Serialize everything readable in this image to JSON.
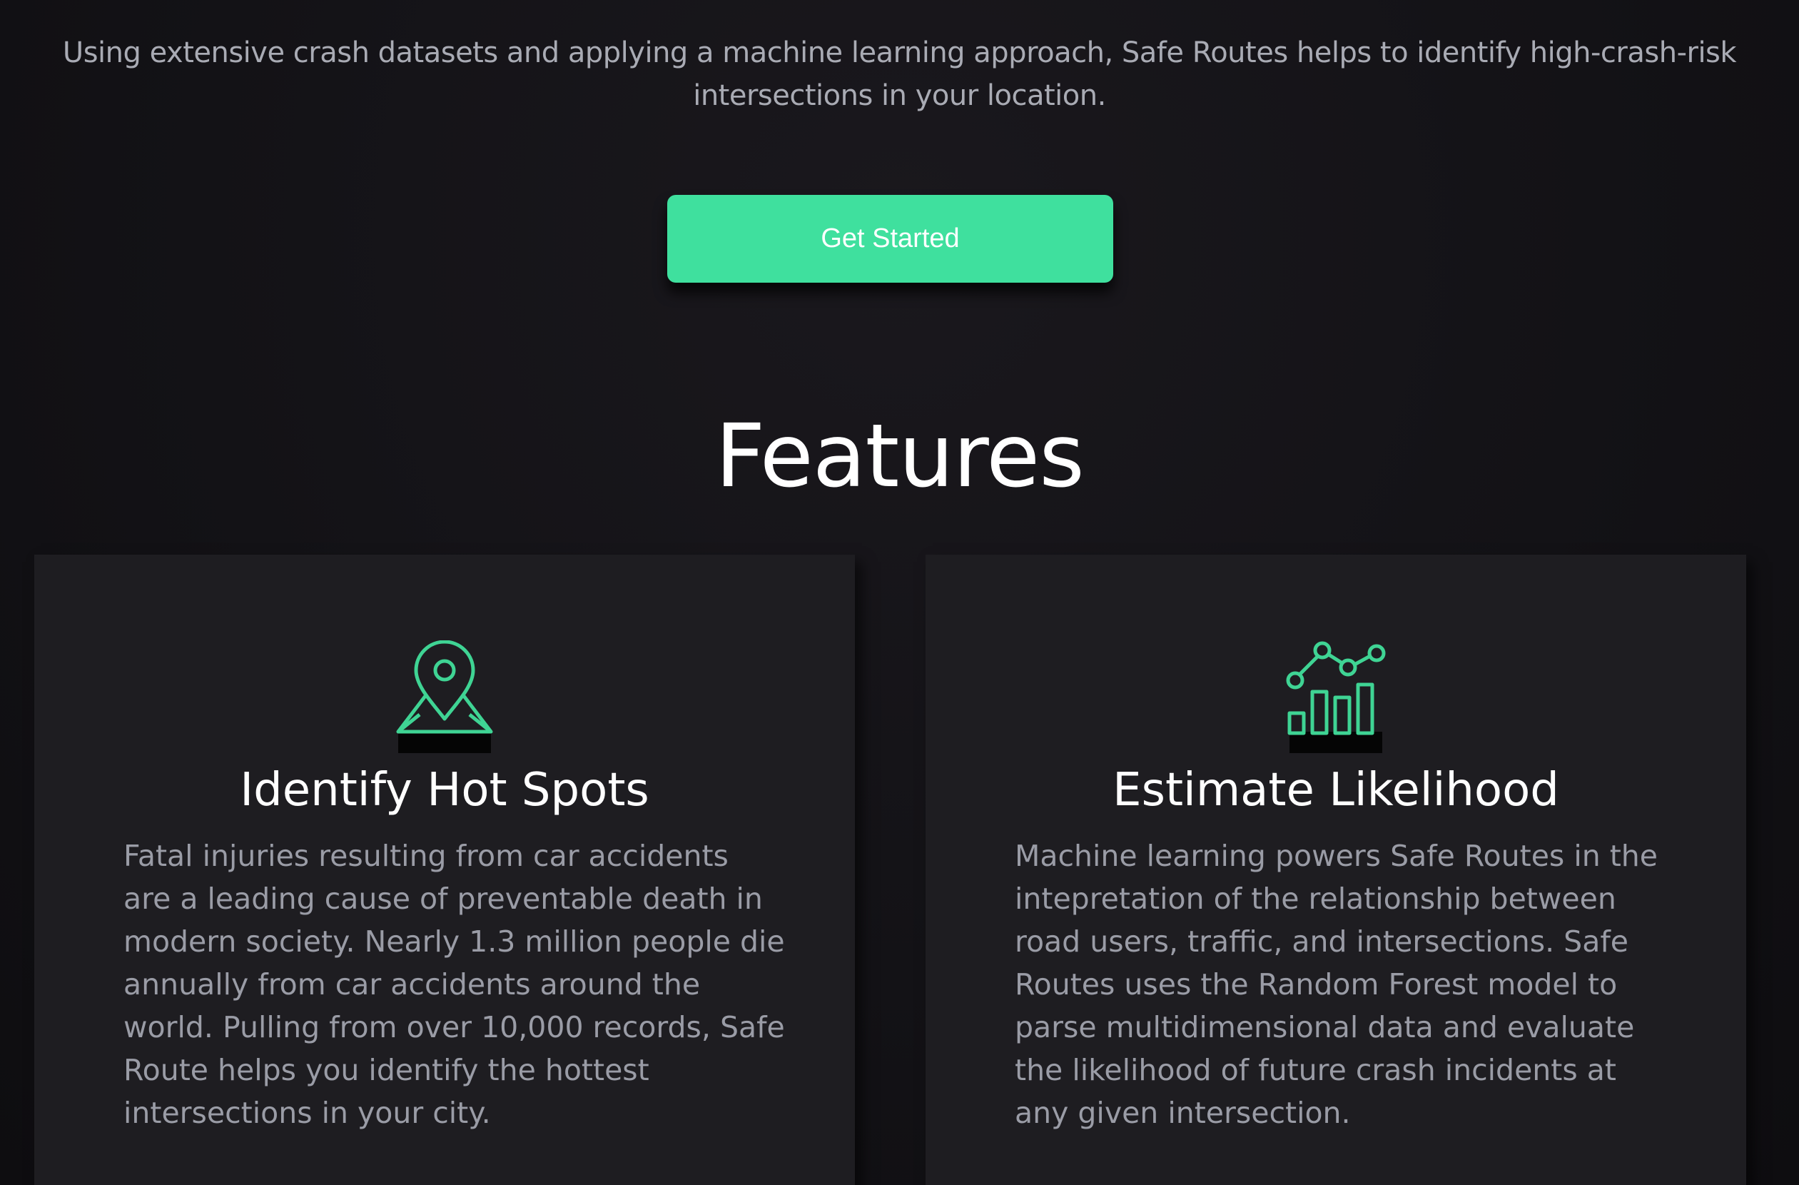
{
  "intro": {
    "line1": "Using extensive crash datasets and applying a machine learning approach, Safe Routes helps to identify high-crash-risk",
    "line2": "intersections in your location."
  },
  "cta": {
    "label": "Get Started"
  },
  "features": {
    "title": "Features",
    "cards": [
      {
        "icon": "map-pin-icon",
        "title": "Identify Hot Spots",
        "lines": [
          "Fatal injuries resulting from car accidents",
          "are a leading cause of preventable death in",
          "modern society. Nearly 1.3 million people die",
          "annually from car accidents around the",
          "world. Pulling from over 10,000 records, Safe",
          "Route helps you identify the hottest",
          "intersections in your city."
        ]
      },
      {
        "icon": "analytics-chart-icon",
        "title": "Estimate Likelihood",
        "lines": [
          "Machine learning powers Safe Routes in the",
          "intepretation of the relationship between",
          "road users, traffic, and intersections. Safe",
          "Routes uses the Random Forest model to",
          "parse multidimensional data and evaluate",
          "the likelihood of future crash incidents at",
          "any given intersection."
        ]
      }
    ]
  },
  "colors": {
    "accent": "#3fe09e",
    "icon_stroke": "#3fd494",
    "background": "#131216",
    "card": "#1e1d21"
  }
}
